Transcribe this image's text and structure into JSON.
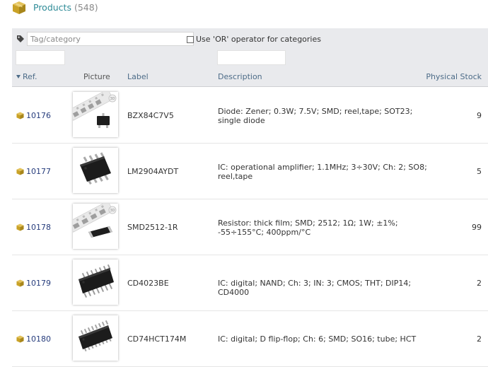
{
  "page": {
    "title": "Products",
    "count": "(548)"
  },
  "filters": {
    "tag_placeholder": "Tag/category",
    "or_operator_label": "Use 'OR' operator for categories",
    "ref_value": "",
    "description_value": ""
  },
  "columns": {
    "ref": "Ref.",
    "picture": "Picture",
    "label": "Label",
    "description": "Description",
    "stock": "Physical Stock"
  },
  "colors": {
    "title": "#2e8b97",
    "link": "#263c7c",
    "header_bg": "#e9eaed",
    "header_text": "#4d6c88",
    "product_icon": "#c9a227"
  },
  "rows": [
    {
      "ref": "10176",
      "label": "BZX84C7V5",
      "description": "Diode: Zener; 0.3W; 7.5V; SMD; reel,tape; SOT23; single diode",
      "stock": "9",
      "picture": "sot23-tape-image"
    },
    {
      "ref": "10177",
      "label": "LM2904AYDT",
      "description": "IC: operational amplifier; 1.1MHz; 3÷30V; Ch: 2; SO8; reel,tape",
      "stock": "5",
      "picture": "so8-chip-image"
    },
    {
      "ref": "10178",
      "label": "SMD2512-1R",
      "description": "Resistor: thick film; SMD; 2512; 1Ω; 1W; ±1%; -55÷155°C; 400ppm/°C",
      "stock": "99",
      "picture": "smd-resistor-tape-image"
    },
    {
      "ref": "10179",
      "label": "CD4023BE",
      "description": "IC: digital; NAND; Ch: 3; IN: 3; CMOS; THT; DIP14; CD4000",
      "stock": "2",
      "picture": "dip14-chip-image"
    },
    {
      "ref": "10180",
      "label": "CD74HCT174M",
      "description": "IC: digital; D flip-flop; Ch: 6; SMD; SO16; tube; HCT",
      "stock": "2",
      "picture": "so16-chip-image"
    }
  ]
}
